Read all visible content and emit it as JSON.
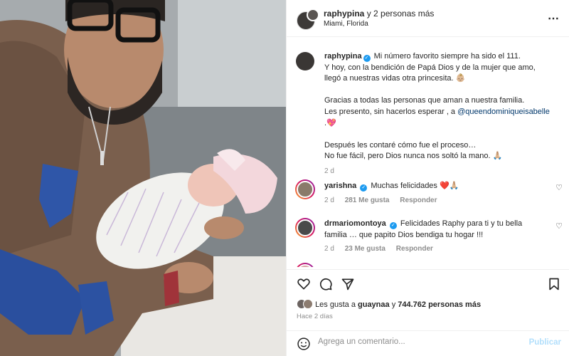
{
  "header": {
    "username": "raphypina",
    "others": " y 2 personas más",
    "location": "Miami, Florida",
    "more_icon": "⋯"
  },
  "caption": {
    "username": "raphypina",
    "line1": "Mi número favorito siempre ha sido el 111.",
    "line2": "Y hoy, con la bendición de Papá Dios y de la mujer que amo,",
    "line3": "llegó a nuestras vidas otra princesita. 👶🏼",
    "line4": "Gracias a todas las personas que aman a nuestra familia.",
    "line5a": "Les presento, sin hacerlos esperar , a ",
    "mention": "@queendominiqueisabelle",
    "line6": ".💖",
    "line7": "Después les contaré cómo fue el proceso…",
    "line8": "No fue fácil, pero Dios nunca nos soltó la mano. 🙏🏼",
    "age": "2 d"
  },
  "comments": [
    {
      "username": "yarishna",
      "text": "Muchas felicidades ❤️🙏🏼",
      "age": "2 d",
      "likes": "281 Me gusta",
      "reply": "Responder",
      "avatar_color": "#8a7a6a"
    },
    {
      "username": "drmariomontoya",
      "text": "Felicidades Raphy para ti y tu bella familia … que papito Dios bendiga tu hogar !!!",
      "age": "2 d",
      "likes": "23 Me gusta",
      "reply": "Responder",
      "avatar_color": "#4a4a4a"
    }
  ],
  "likes": {
    "prefix": "Les gusta a ",
    "user": "guaynaa",
    "joiner": " y ",
    "count": "744.762 personas más"
  },
  "time": "Hace 2 días",
  "add_comment": {
    "placeholder": "Agrega un comentario...",
    "post_label": "Publicar"
  },
  "colors": {
    "verified": "#1d9bf0",
    "mention": "#00376b",
    "muted": "#8e8e8e",
    "post_disabled": "#b2dffc"
  },
  "icons": [
    "heart-icon",
    "comment-icon",
    "share-icon",
    "bookmark-icon",
    "emoji-icon",
    "more-icon",
    "verified-icon"
  ]
}
